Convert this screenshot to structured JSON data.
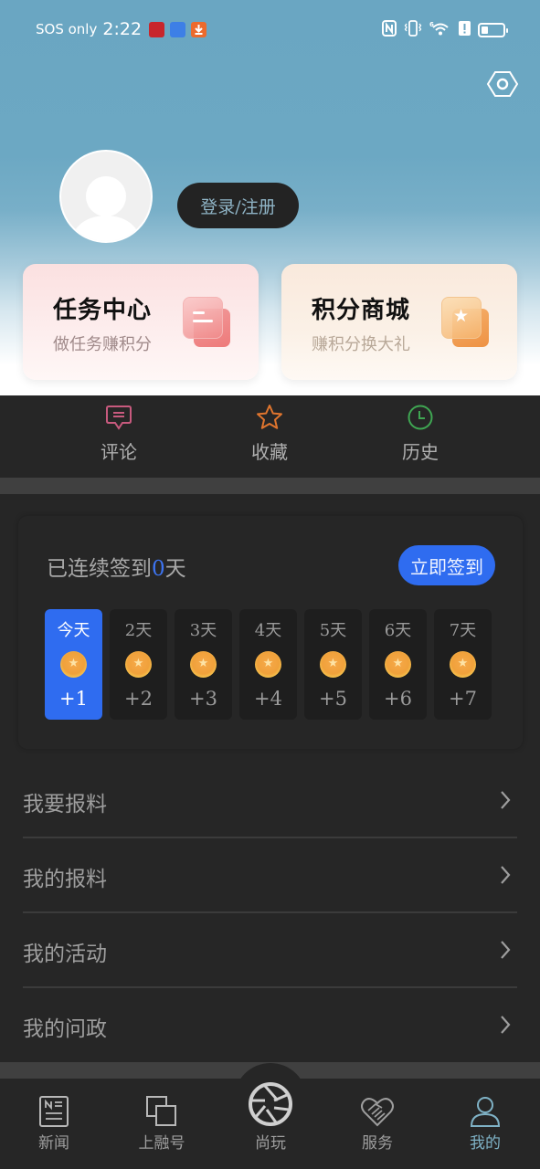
{
  "status_bar": {
    "carrier": "SOS only",
    "time": "2:22",
    "notification_icons": [
      "news-app-icon",
      "browser-app-icon",
      "download-icon"
    ],
    "right_icons": [
      "nfc-icon",
      "vibrate-icon",
      "wifi-6-icon",
      "alert-icon",
      "battery-icon"
    ],
    "wifi_badge": "6"
  },
  "header": {
    "settings_icon": "settings-hexagon-icon",
    "login_label": "登录/注册"
  },
  "cards": [
    {
      "title": "任务中心",
      "subtitle": "做任务赚积分",
      "icon": "task-list-icon"
    },
    {
      "title": "积分商城",
      "subtitle": "赚积分换大礼",
      "icon": "star-mall-icon"
    }
  ],
  "quick_actions": [
    {
      "label": "评论",
      "icon": "comment-icon",
      "color": "#c85a7e"
    },
    {
      "label": "收藏",
      "icon": "star-icon",
      "color": "#e0752e"
    },
    {
      "label": "历史",
      "icon": "clock-icon",
      "color": "#3fa652"
    }
  ],
  "signin": {
    "prefix": "已连续签到",
    "count": "0",
    "suffix": "天",
    "button_label": "立即签到",
    "accent": "#2f6cf0",
    "days": [
      {
        "label": "今天",
        "points": "+1",
        "active": true
      },
      {
        "label": "2天",
        "points": "+2",
        "active": false
      },
      {
        "label": "3天",
        "points": "+3",
        "active": false
      },
      {
        "label": "4天",
        "points": "+4",
        "active": false
      },
      {
        "label": "5天",
        "points": "+5",
        "active": false
      },
      {
        "label": "6天",
        "points": "+6",
        "active": false
      },
      {
        "label": "7天",
        "points": "+7",
        "active": false
      }
    ],
    "coin_glyph": "★"
  },
  "menu": [
    {
      "label": "我要报料"
    },
    {
      "label": "我的报料"
    },
    {
      "label": "我的活动"
    },
    {
      "label": "我的问政"
    }
  ],
  "bottom_nav": [
    {
      "label": "新闻",
      "icon": "news-icon",
      "active": false
    },
    {
      "label": "上融号",
      "icon": "copy-squares-icon",
      "active": false
    },
    {
      "label": "尚玩",
      "icon": "camera-aperture-icon",
      "active": false
    },
    {
      "label": "服务",
      "icon": "heart-handshake-icon",
      "active": false
    },
    {
      "label": "我的",
      "icon": "user-icon",
      "active": true
    }
  ]
}
